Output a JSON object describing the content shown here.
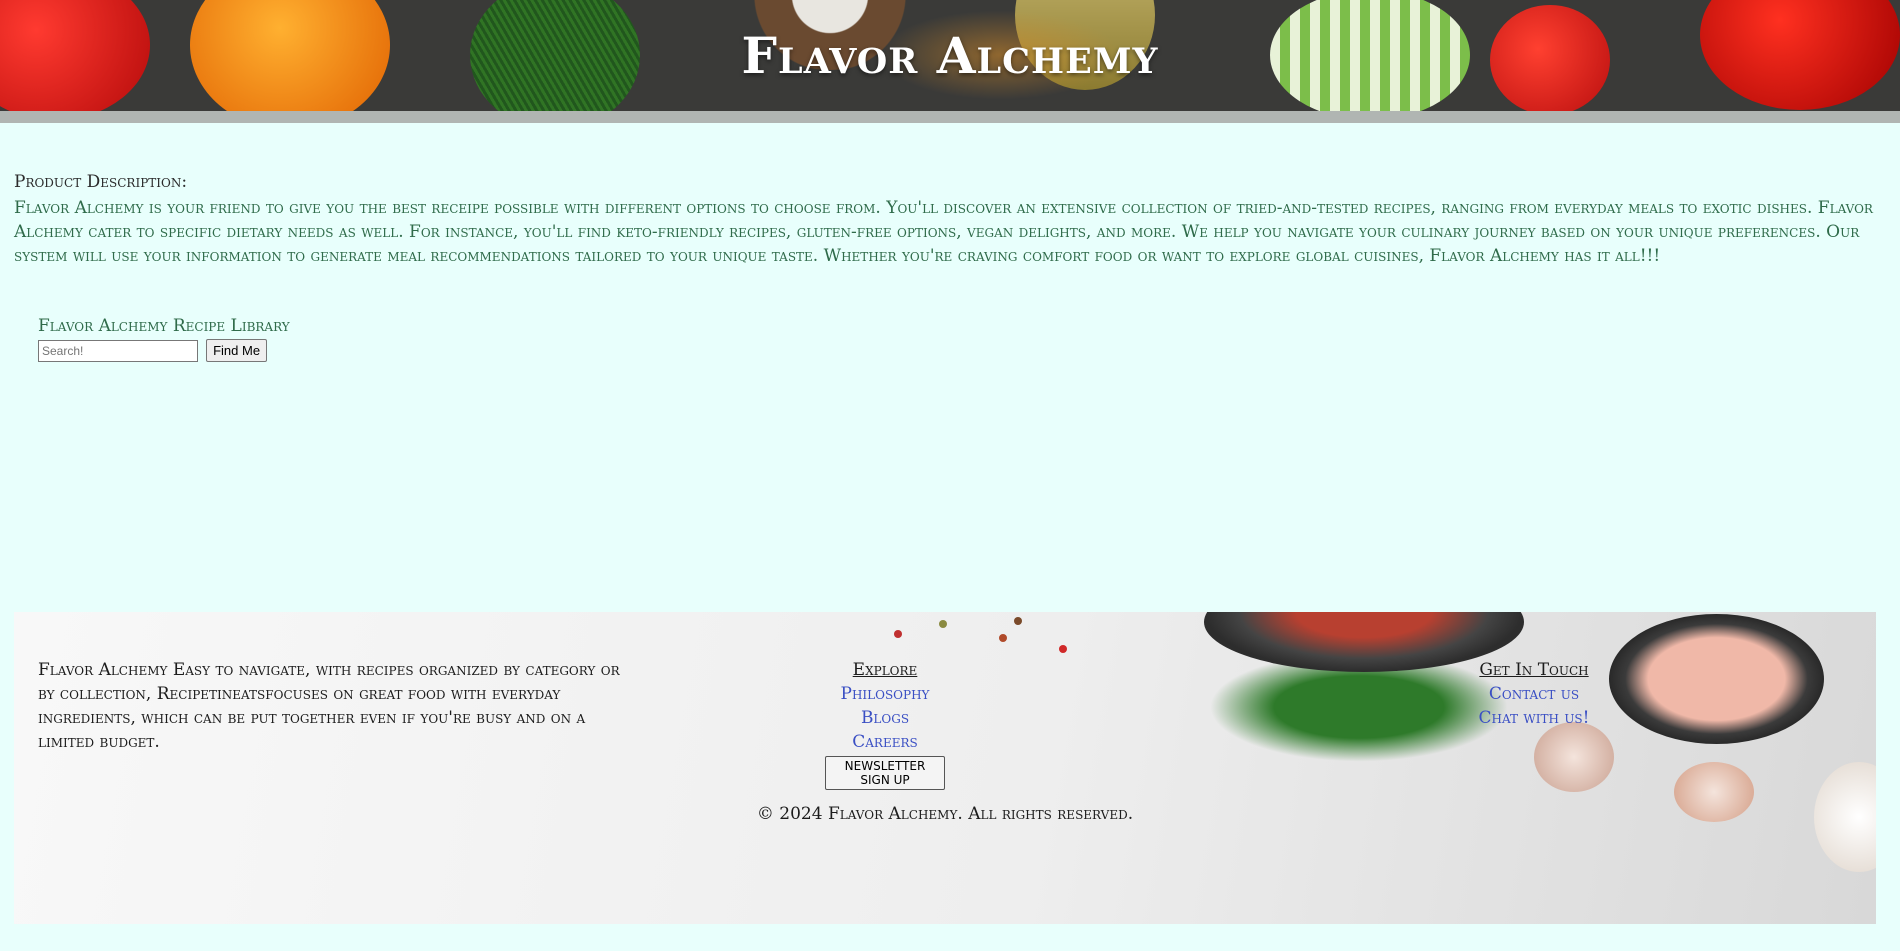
{
  "header": {
    "title": "Flavor Alchemy"
  },
  "main": {
    "description_label": "Product Description:",
    "description_text": "Flavor Alchemy is your friend to give you the best receipe possible with different options to choose from. You'll discover an extensive collection of tried-and-tested recipes, ranging from everyday meals to exotic dishes. Flavor Alchemy cater to specific dietary needs as well. For instance, you'll find keto-friendly recipes, gluten-free options, vegan delights, and more. We help you navigate your culinary journey based on your unique preferences. Our system will use your information to generate meal recommendations tailored to your unique taste. Whether you're craving comfort food or want to explore global cuisines, Flavor Alchemy has it all!!!",
    "library_title": "Flavor Alchemy Recipe Library",
    "search_placeholder": "Search!",
    "search_button": "Find Me"
  },
  "footer": {
    "about": "Flavor Alchemy Easy to navigate, with recipes organized by category or by collection, Recipetineatsfocuses on great food with everyday ingredients, which can be put together even if you're busy and on a limited budget.",
    "explore": {
      "heading": "Explore",
      "links": [
        "Philosophy",
        "Blogs",
        "Careers"
      ],
      "newsletter_button": "Newsletter Sign Up"
    },
    "contact": {
      "heading": "Get In Touch",
      "links": [
        "Contact us",
        "Chat with us!"
      ]
    },
    "copyright": "© 2024 Flavor Alchemy. All rights reserved."
  },
  "colors": {
    "page_background": "#e8fffc",
    "description_text": "#2f6b4a",
    "link": "#3a4fc4",
    "header_bar": "#b0b5b2"
  }
}
